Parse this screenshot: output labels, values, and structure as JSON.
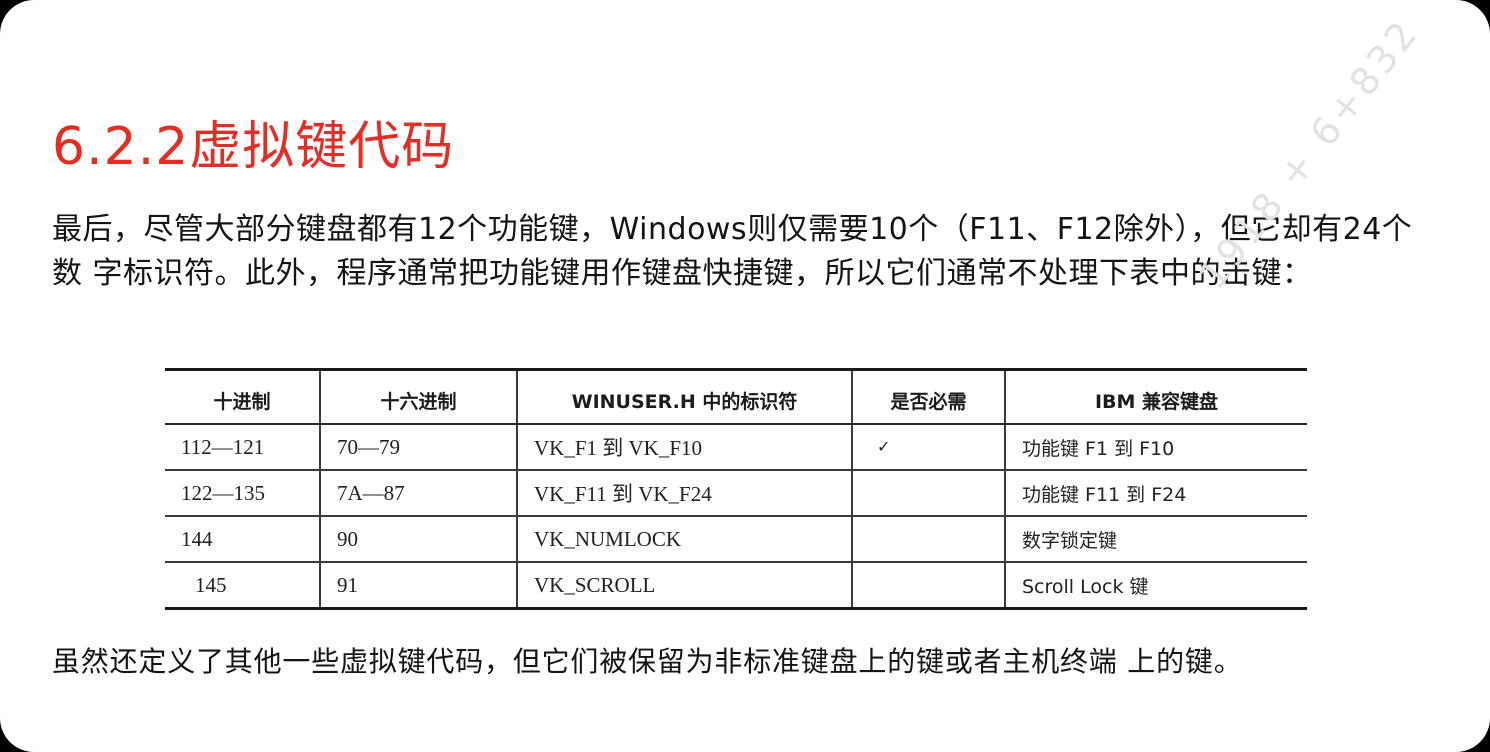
{
  "title": "6.2.2虚拟键代码",
  "intro_text": "最后，尽管大部分键盘都有12个功能键，Windows则仅需要10个（F11、F12除外），但它却有24个数 字标识符。此外，程序通常把功能键用作键盘快捷键，所以它们通常不处理下表中的击键：",
  "table": {
    "headers": [
      "十进制",
      "十六进制",
      "WINUSER.H 中的标识符",
      "是否必需",
      "IBM 兼容键盘"
    ],
    "rows": [
      [
        "112—121",
        "70—79",
        "VK_F1  到  VK_F10",
        "✓",
        "功能键 F1 到 F10"
      ],
      [
        "122—135",
        "7A—87",
        "VK_F11 到 VK_F24",
        "",
        "功能键 F11 到 F24"
      ],
      [
        "144",
        "90",
        "VK_NUMLOCK",
        "",
        "数字锁定键"
      ],
      [
        "145",
        "91",
        "VK_SCROLL",
        "",
        "Scroll Lock 键"
      ]
    ]
  },
  "closing_text": "虽然还定义了其他一些虚拟键代码，但它们被保留为非标准键盘上的键或者主机终端 上的键。",
  "watermark": "1918 + 6+832",
  "colors": {
    "title": "#e42d24",
    "text": "#141414",
    "background": "#ffffff"
  }
}
